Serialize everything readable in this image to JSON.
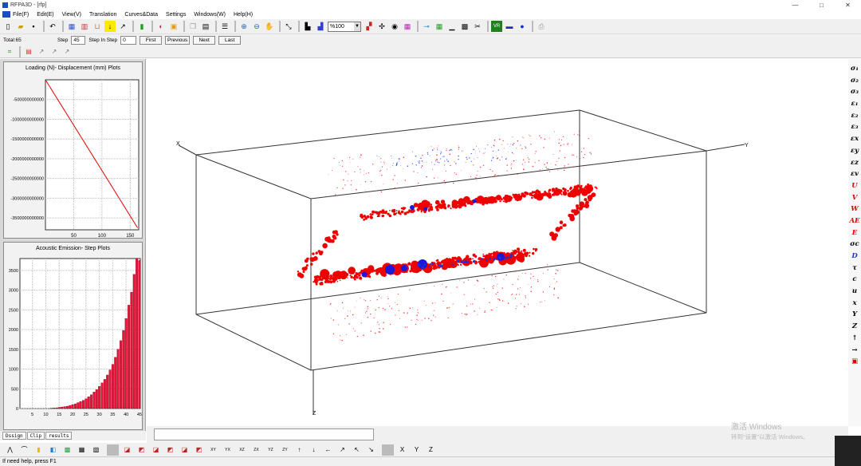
{
  "window": {
    "title": "RFPA3D - [rfp]",
    "minimize": "—",
    "maximize": "□",
    "close": "✕"
  },
  "menu": [
    "File(F)",
    "Edit(E)",
    "View(V)",
    "Translation",
    "Curves&Data",
    "Settings",
    "Windows(W)",
    "Help(H)"
  ],
  "toolbar": {
    "zoom_value": "%100"
  },
  "stepbar": {
    "total": "Total:65",
    "step_label": "Step",
    "step_value": "45",
    "step_in_step_label": "Step In Step",
    "step_in_step_value": "0",
    "first": "First",
    "previous": "Previous",
    "next": "Next",
    "last": "Last"
  },
  "axes3d": {
    "x": "X",
    "y": "Y",
    "z": "Z"
  },
  "right_symbols": [
    "σ₁",
    "σ₂",
    "σ₃",
    "ε₁",
    "ε₂",
    "ε₃",
    "εx",
    "εy",
    "εz",
    "εv",
    "U",
    "V",
    "W",
    "AE",
    "E",
    "σc",
    "D",
    "τ",
    "c",
    "u",
    "x",
    "Y",
    "Z",
    "↑",
    "→",
    "▣"
  ],
  "right_colors": {
    "sigma": "#000000",
    "disp": "#e00000",
    "d": "#1a3ad0"
  },
  "tabs": [
    "Dssign",
    "Clip",
    "results"
  ],
  "status": "If need help, press F1",
  "watermark": {
    "line1": "激活 Windows",
    "line2": "转到“设置”以激活 Windows。"
  },
  "chart_data": [
    {
      "type": "line",
      "title": "Loading (N)- Displacement (mm) Plots",
      "xlabel": "",
      "ylabel": "",
      "xlim": [
        0,
        165
      ],
      "ylim": [
        -3800000000000,
        0
      ],
      "xticks": [
        "50",
        "100",
        "150"
      ],
      "yticks": [
        "-500000000000",
        "-1000000000000",
        "-1500000000000",
        "-2000000000000",
        "-2500000000000",
        "-3000000000000",
        "-3500000000000"
      ],
      "ytick_values": [
        -500000000000,
        -1000000000000,
        -1500000000000,
        -2000000000000,
        -2500000000000,
        -3000000000000,
        -3500000000000
      ],
      "xtick_values": [
        50,
        100,
        150
      ],
      "series": [
        {
          "color": "#e00000",
          "x": [
            0,
            163
          ],
          "y": [
            0,
            -3750000000000
          ]
        }
      ],
      "grid": true
    },
    {
      "type": "bar",
      "title": "Acoustic Emission- Step Plots",
      "xlabel": "",
      "ylabel": "",
      "xlim": [
        1,
        45
      ],
      "ylim": [
        0,
        3800
      ],
      "xticks": [
        "5",
        "10",
        "15",
        "20",
        "25",
        "30",
        "35",
        "40",
        "45"
      ],
      "yticks": [
        "0",
        "500",
        "1000",
        "1500",
        "2000",
        "2500",
        "3000",
        "3500"
      ],
      "color": "#e8123c",
      "categories": [
        1,
        2,
        3,
        4,
        5,
        6,
        7,
        8,
        9,
        10,
        11,
        12,
        13,
        14,
        15,
        16,
        17,
        18,
        19,
        20,
        21,
        22,
        23,
        24,
        25,
        26,
        27,
        28,
        29,
        30,
        31,
        32,
        33,
        34,
        35,
        36,
        37,
        38,
        39,
        40,
        41,
        42,
        43,
        44,
        45
      ],
      "values": [
        0,
        0,
        0,
        0,
        0,
        0,
        0,
        0,
        0,
        0,
        0,
        10,
        15,
        20,
        30,
        40,
        50,
        60,
        80,
        100,
        120,
        150,
        180,
        210,
        250,
        300,
        350,
        420,
        480,
        560,
        650,
        740,
        850,
        980,
        1120,
        1300,
        1500,
        1720,
        1980,
        2280,
        2620,
        2950,
        3400,
        3800,
        3750
      ],
      "grid": true
    }
  ]
}
